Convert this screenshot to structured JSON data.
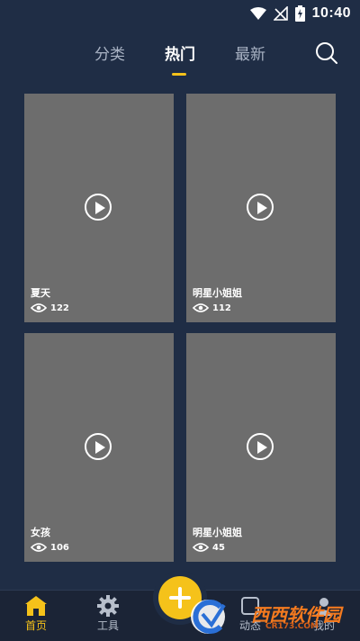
{
  "status_bar": {
    "time": "10:40"
  },
  "tabs": [
    {
      "label": "分类",
      "active": false
    },
    {
      "label": "热门",
      "active": true
    },
    {
      "label": "最新",
      "active": false
    }
  ],
  "cards": [
    {
      "title": "夏天",
      "views": "122"
    },
    {
      "title": "明星小姐姐",
      "views": "112"
    },
    {
      "title": "女孩",
      "views": "106"
    },
    {
      "title": "明星小姐姐",
      "views": "45"
    }
  ],
  "bottom_nav": [
    {
      "label": "首页",
      "icon": "home-icon",
      "active": true
    },
    {
      "label": "工具",
      "icon": "gear-icon",
      "active": false
    },
    {
      "label": "动态",
      "icon": "activity-icon",
      "active": false
    },
    {
      "label": "我的",
      "icon": "profile-icon",
      "active": false
    }
  ],
  "watermark": {
    "text": "西西软件园",
    "sub": "CR173.COM"
  },
  "colors": {
    "accent": "#f5c21a",
    "background": "#1f2d45",
    "card": "#6d6d6d"
  }
}
